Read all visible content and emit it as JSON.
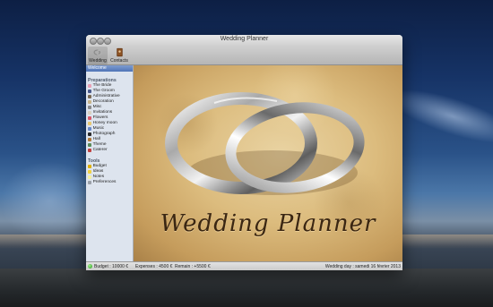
{
  "window": {
    "title": "Wedding Planner"
  },
  "toolbar": {
    "items": [
      {
        "label": "Wedding",
        "icon": "rings-icon",
        "active": true
      },
      {
        "label": "Contacts",
        "icon": "address-book-icon",
        "active": false
      }
    ]
  },
  "sidebar": {
    "welcome": "Welcome",
    "preparations": {
      "title": "Preparations",
      "items": [
        {
          "label": "The Bride",
          "icon": "bride-icon",
          "color": "#e8a0b4"
        },
        {
          "label": "The Groom",
          "icon": "groom-icon",
          "color": "#4a5a8a"
        },
        {
          "label": "Administrative",
          "icon": "admin-icon",
          "color": "#7a6a52"
        },
        {
          "label": "Decoration",
          "icon": "decoration-icon",
          "color": "#c8b48a"
        },
        {
          "label": "Misc",
          "icon": "misc-icon",
          "color": "#8a8a8a"
        },
        {
          "label": "Invitations",
          "icon": "invitations-icon",
          "color": "#d8d0c0"
        },
        {
          "label": "Flowers",
          "icon": "flowers-icon",
          "color": "#d85a6a"
        },
        {
          "label": "Honey moon",
          "icon": "honeymoon-icon",
          "color": "#e8c870"
        },
        {
          "label": "Music",
          "icon": "music-icon",
          "color": "#6a8ac8"
        },
        {
          "label": "Photograph",
          "icon": "camera-icon",
          "color": "#2a2a2a"
        },
        {
          "label": "Hall",
          "icon": "hall-icon",
          "color": "#b07a3a"
        },
        {
          "label": "Theme",
          "icon": "theme-icon",
          "color": "#5a8a5a"
        },
        {
          "label": "Caterer",
          "icon": "caterer-icon",
          "color": "#c04040"
        }
      ]
    },
    "tools": {
      "title": "Tools",
      "items": [
        {
          "label": "Budget",
          "icon": "budget-icon",
          "color": "#e0b000"
        },
        {
          "label": "Ideas",
          "icon": "ideas-icon",
          "color": "#f0d040"
        },
        {
          "label": "Notes",
          "icon": "notes-icon",
          "color": "#f4f0a0"
        },
        {
          "label": "Preferences",
          "icon": "preferences-icon",
          "color": "#9aa0a8"
        }
      ]
    }
  },
  "main": {
    "logo_text": "Wedding Planner"
  },
  "status": {
    "budget": "Budget : 10000 €",
    "expenses": "Expenses : 4500 €",
    "remain": "Remain : +5500 €",
    "wedding_day": "Wedding day : samedi 16 février 2013"
  }
}
